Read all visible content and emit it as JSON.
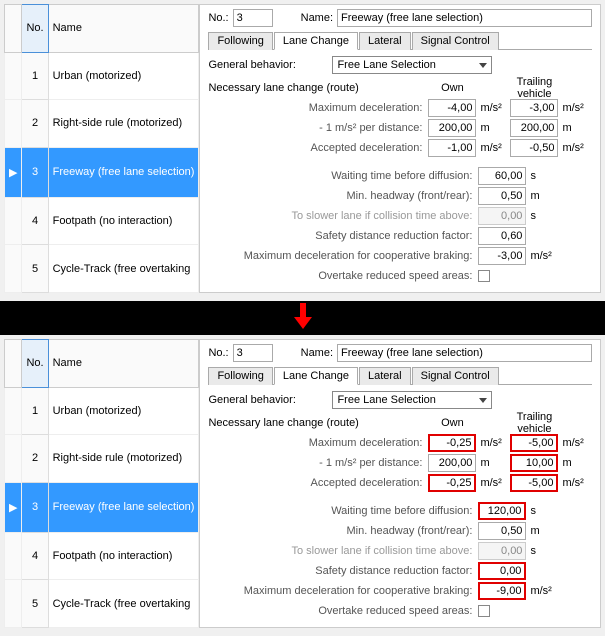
{
  "list": {
    "headers": {
      "no": "No.",
      "name": "Name"
    },
    "rows": [
      {
        "no": "1",
        "name": "Urban (motorized)"
      },
      {
        "no": "2",
        "name": "Right-side rule (motorized)"
      },
      {
        "no": "3",
        "name": "Freeway (free lane selection)"
      },
      {
        "no": "4",
        "name": "Footpath (no interaction)"
      },
      {
        "no": "5",
        "name": "Cycle-Track (free overtaking"
      }
    ],
    "selected_index": 2
  },
  "header": {
    "no_label": "No.:",
    "no_value": "3",
    "name_label": "Name:",
    "name_value": "Freeway (free lane selection)"
  },
  "tabs": {
    "following": "Following",
    "lane_change": "Lane Change",
    "lateral": "Lateral",
    "signal_control": "Signal Control"
  },
  "general_behavior_label": "General behavior:",
  "general_behavior_value": "Free Lane Selection",
  "nec_title": "Necessary lane change (route)",
  "own_header": "Own",
  "trail_header": "Trailing vehicle",
  "labels": {
    "max_decel": "Maximum deceleration:",
    "per_dist": "- 1 m/s² per distance:",
    "acc_decel": "Accepted deceleration:",
    "wait_diff": "Waiting time before diffusion:",
    "min_hw": "Min. headway (front/rear):",
    "slower_if": "To slower lane if collision time above:",
    "safety": "Safety distance reduction factor:",
    "coop_brake": "Maximum deceleration for cooperative braking:",
    "overtake": "Overtake reduced speed areas:"
  },
  "units": {
    "ms2": "m/s²",
    "m": "m",
    "s": "s"
  },
  "before": {
    "max_decel_own": "-4,00",
    "max_decel_trail": "-3,00",
    "per_dist_own": "200,00",
    "per_dist_trail": "200,00",
    "acc_decel_own": "-1,00",
    "acc_decel_trail": "-0,50",
    "wait_diff": "60,00",
    "min_hw": "0,50",
    "slower_if": "0,00",
    "safety": "0,60",
    "coop_brake": "-3,00"
  },
  "after": {
    "max_decel_own": "-0,25",
    "max_decel_trail": "-5,00",
    "per_dist_own": "200,00",
    "per_dist_trail": "10,00",
    "acc_decel_own": "-0,25",
    "acc_decel_trail": "-5,00",
    "wait_diff": "120,00",
    "min_hw": "0,50",
    "slower_if": "0,00",
    "safety": "0,00",
    "coop_brake": "-9,00"
  }
}
